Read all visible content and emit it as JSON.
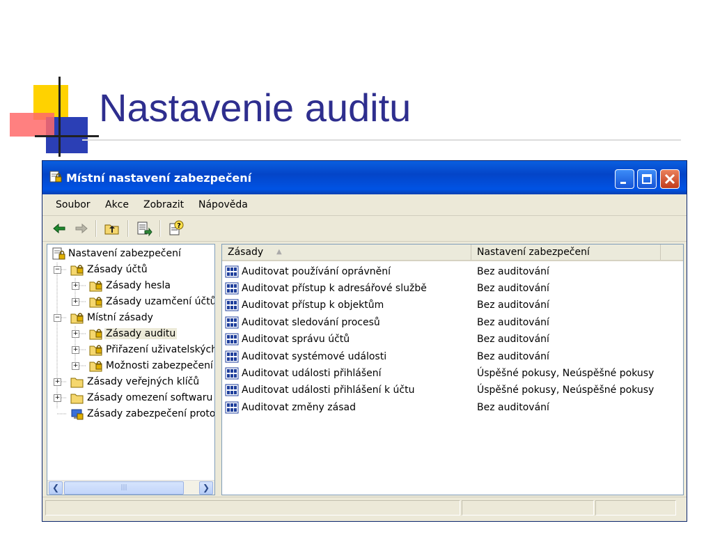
{
  "slide": {
    "title": "Nastavenie auditu"
  },
  "window": {
    "title": "Místní nastavení zabezpečení",
    "menu": [
      "Soubor",
      "Akce",
      "Zobrazit",
      "Nápověda"
    ]
  },
  "tree": {
    "items": [
      {
        "label": "Nastavení zabezpečení",
        "icon": "security-settings-icon"
      },
      {
        "label": "Zásady účtů",
        "icon": "policy-folder-icon"
      },
      {
        "label": "Zásady hesla",
        "icon": "policy-folder-icon"
      },
      {
        "label": "Zásady uzamčení účtů",
        "icon": "policy-folder-icon"
      },
      {
        "label": "Místní zásady",
        "icon": "policy-folder-icon"
      },
      {
        "label": "Zásady auditu",
        "icon": "policy-folder-icon",
        "selected": true
      },
      {
        "label": "Přiřazení uživatelských",
        "icon": "policy-folder-icon"
      },
      {
        "label": "Možnosti zabezpečení",
        "icon": "policy-folder-icon"
      },
      {
        "label": "Zásady veřejných klíčů",
        "icon": "folder-icon"
      },
      {
        "label": "Zásady omezení softwaru",
        "icon": "folder-icon"
      },
      {
        "label": "Zásady zabezpečení protok",
        "icon": "ip-security-icon"
      }
    ]
  },
  "list": {
    "columns": [
      "Zásady",
      "Nastavení zabezpečení"
    ],
    "rows": [
      {
        "policy": "Auditovat používání oprávnění",
        "setting": "Bez auditování"
      },
      {
        "policy": "Auditovat přístup k adresářové službě",
        "setting": "Bez auditování"
      },
      {
        "policy": "Auditovat přístup k objektům",
        "setting": "Bez auditování"
      },
      {
        "policy": "Auditovat sledování procesů",
        "setting": "Bez auditování"
      },
      {
        "policy": "Auditovat správu účtů",
        "setting": "Bez auditování"
      },
      {
        "policy": "Auditovat systémové události",
        "setting": "Bez auditování"
      },
      {
        "policy": "Auditovat události přihlášení",
        "setting": "Úspěšné pokusy, Neúspěšné pokusy"
      },
      {
        "policy": "Auditovat události přihlášení k účtu",
        "setting": "Úspěšné pokusy, Neúspěšné pokusy"
      },
      {
        "policy": "Auditovat změny zásad",
        "setting": "Bez auditování"
      }
    ]
  },
  "colors": {
    "title": "#2e2e8e",
    "titlebar": "#0053e4",
    "window_bg": "#ece9d8"
  }
}
